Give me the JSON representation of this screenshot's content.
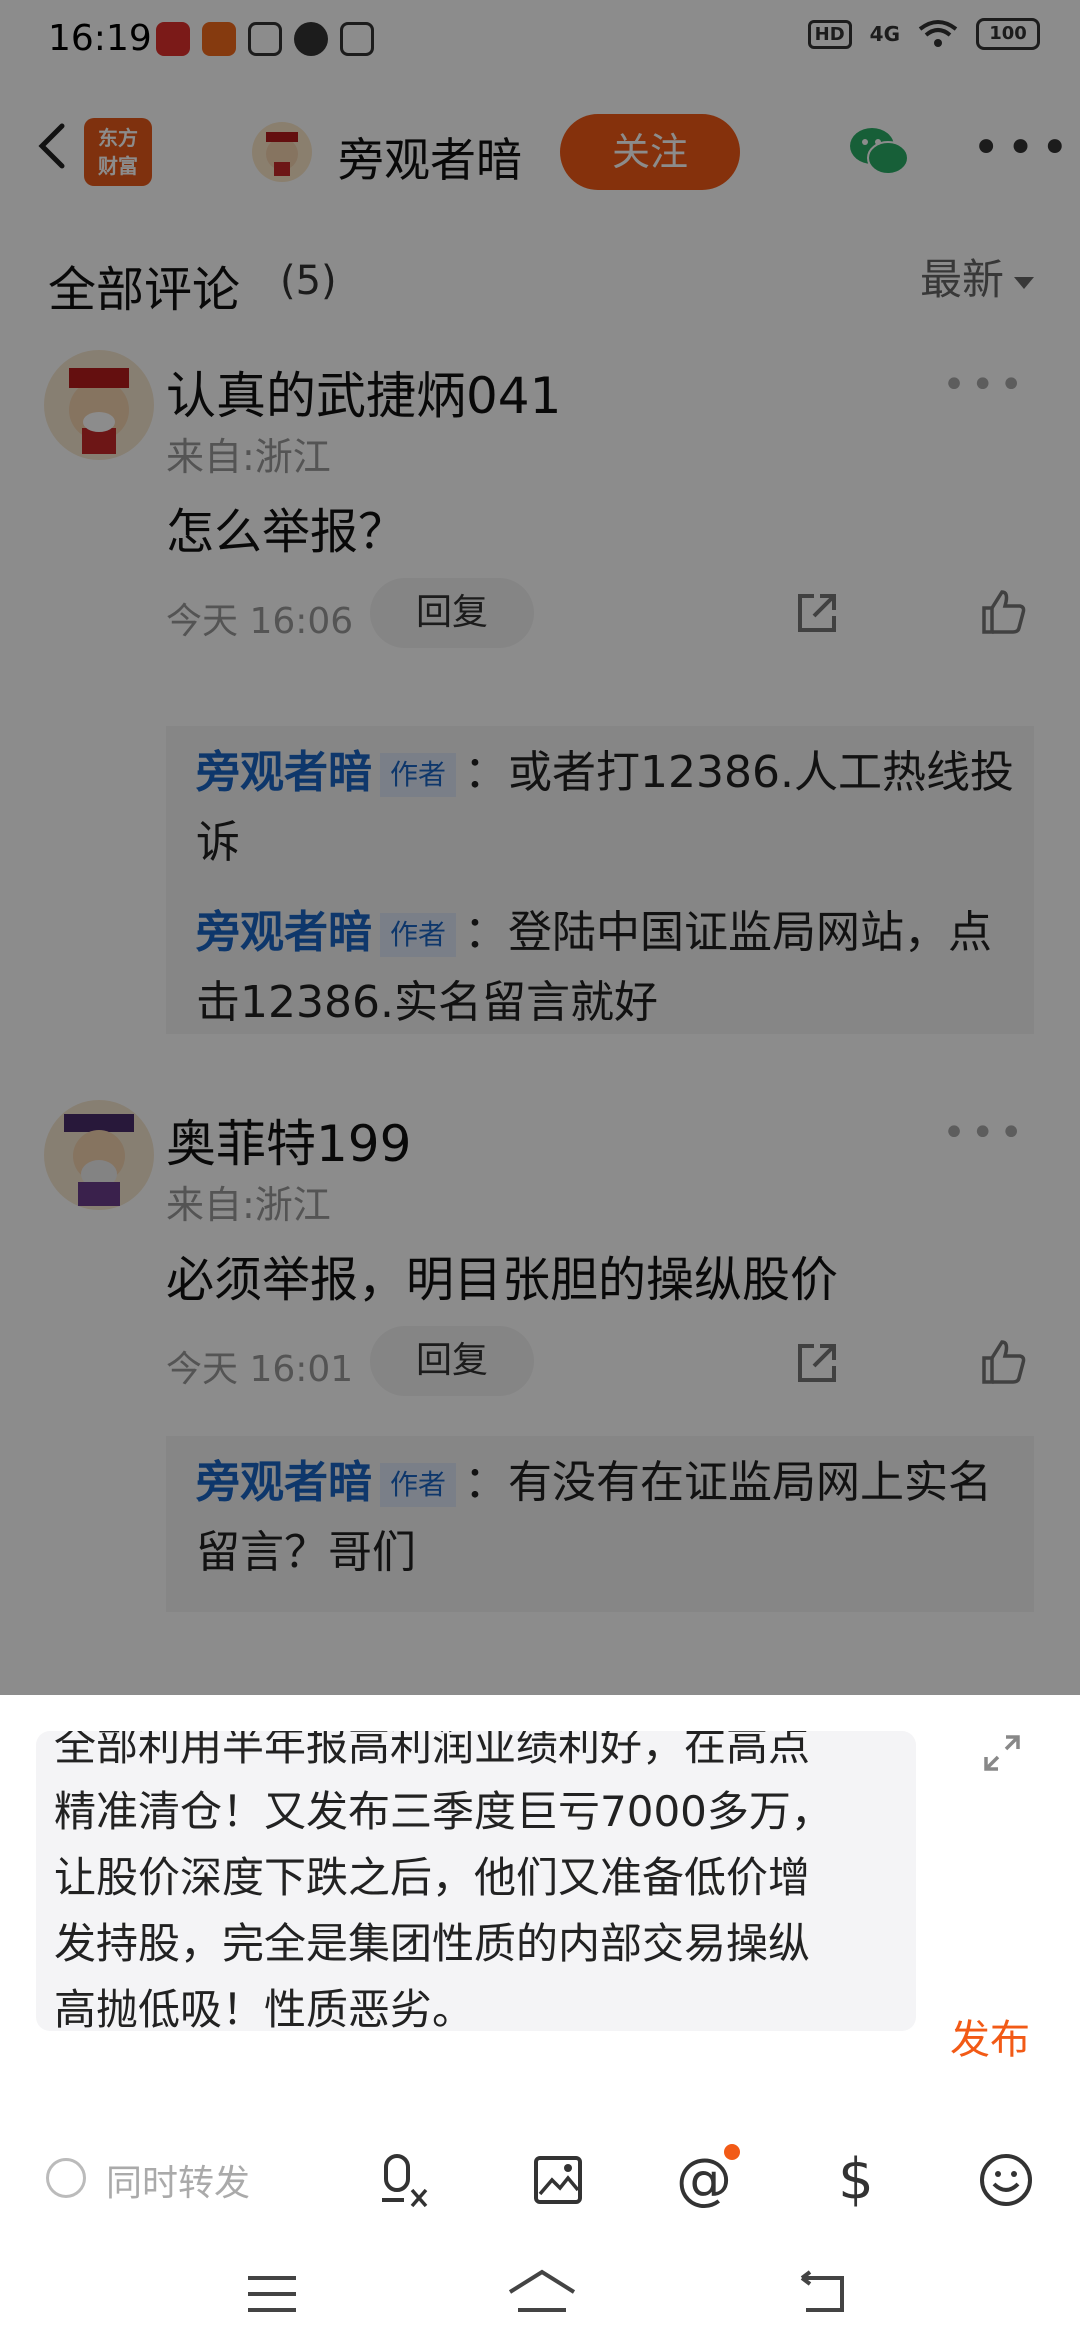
{
  "status_bar": {
    "time": "16:19",
    "hd": "HD",
    "signal": "4G",
    "battery": "100",
    "app_icons": [
      "toutiao-icon",
      "message-app-icon",
      "wechat-icon",
      "chat-bubble-icon",
      "taobao-icon"
    ]
  },
  "nav": {
    "logo_line1": "东方",
    "logo_line2": "财富",
    "title": "旁观者暗",
    "follow_label": "关注"
  },
  "comments_header": {
    "title": "全部评论",
    "count": "(5)",
    "sort_label": "最新"
  },
  "comments": [
    {
      "username": "认真的武捷炳041",
      "from": "来自:浙江",
      "content": "怎么举报？",
      "time": "今天 16:06",
      "reply_label": "回复",
      "replies": [
        {
          "name": "旁观者暗",
          "tag": "作者",
          "text": "：或者打12386.人工热线投诉"
        },
        {
          "name": "旁观者暗",
          "tag": "作者",
          "text": "：登陆中国证监局网站，点击12386.实名留言就好"
        }
      ]
    },
    {
      "username": "奥菲特199",
      "from": "来自:浙江",
      "content": "必须举报，明目张胆的操纵股价",
      "time": "今天 16:01",
      "reply_label": "回复",
      "replies": [
        {
          "name": "旁观者暗",
          "tag": "作者",
          "text": "：有没有在证监局网上实名留言？哥们"
        }
      ]
    }
  ],
  "composer": {
    "partial_first_line": "全部利用半年报高利润业绩利好，在高点",
    "lines": [
      "精准清仓！又发布三季度巨亏7000多万，",
      "让股价深度下跌之后，他们又准备低价增",
      "发持股，完全是集团性质的内部交易操纵",
      "高抛低吸！性质恶劣。"
    ],
    "publish_label": "发布",
    "repost_label": "同时转发"
  },
  "colors": {
    "accent": "#f25a16",
    "link_blue": "#1b64c4"
  }
}
